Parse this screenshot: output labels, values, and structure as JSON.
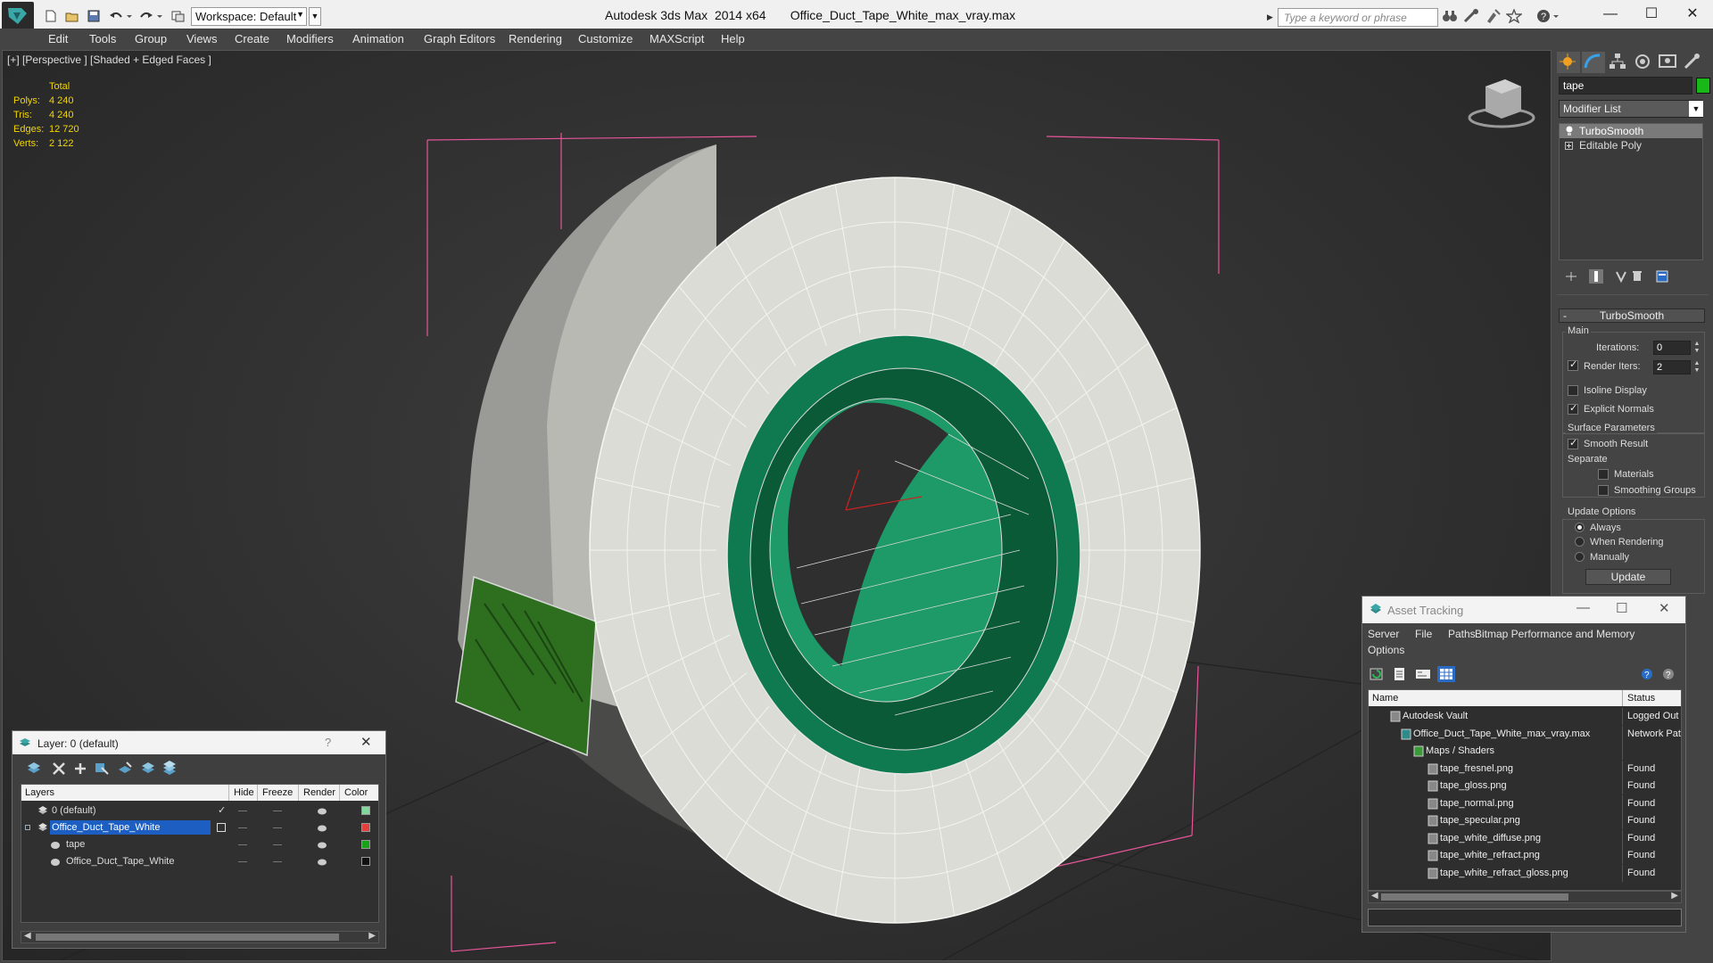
{
  "titlebar": {
    "workspace": "Workspace: Default",
    "title": "Autodesk 3ds Max  2014 x64       Office_Duct_Tape_White_max_vray.max",
    "search_placeholder": "Type a keyword or phrase"
  },
  "menu": [
    "Edit",
    "Tools",
    "Group",
    "Views",
    "Create",
    "Modifiers",
    "Animation",
    "Graph Editors",
    "Rendering",
    "Customize",
    "MAXScript",
    "Help"
  ],
  "viewport": {
    "label": "[+] [Perspective ] [Shaded + Edged Faces ]",
    "stats": {
      "header": "Total",
      "rows": [
        {
          "key": "Polys:",
          "value": "4 240"
        },
        {
          "key": "Tris:",
          "value": "4 240"
        },
        {
          "key": "Edges:",
          "value": "12 720"
        },
        {
          "key": "Verts:",
          "value": "2 122"
        }
      ]
    }
  },
  "command_panel": {
    "object_name": "tape",
    "object_color": "#18b818",
    "modifier_list": "Modifier List",
    "stack": [
      "TurboSmooth",
      "Editable Poly"
    ],
    "rollout": {
      "title": "TurboSmooth",
      "main_group": "Main",
      "iterations_label": "Iterations:",
      "iterations": "0",
      "render_iters_label": "Render Iters:",
      "render_iters": "2",
      "isoline": "Isoline Display",
      "explicit_normals": "Explicit Normals",
      "surface_group": "Surface Parameters",
      "smooth_result": "Smooth Result",
      "separate": "Separate",
      "materials": "Materials",
      "smoothing_groups": "Smoothing Groups",
      "update_group": "Update Options",
      "always": "Always",
      "when_rendering": "When Rendering",
      "manually": "Manually",
      "update_button": "Update"
    }
  },
  "layer_dialog": {
    "title": "Layer: 0 (default)",
    "help": "?",
    "columns": [
      "Layers",
      "Hide",
      "Freeze",
      "Render",
      "Color"
    ],
    "rows": [
      {
        "name": "0 (default)",
        "color": "#7fd99a",
        "indent": 0
      },
      {
        "name": "Office_Duct_Tape_White",
        "color": "#e0413a",
        "indent": 0
      },
      {
        "name": "tape",
        "color": "#17a317",
        "indent": 1
      },
      {
        "name": "Office_Duct_Tape_White",
        "color": "#111111",
        "indent": 1
      }
    ]
  },
  "asset_dialog": {
    "title": "Asset Tracking",
    "menu": [
      "Server",
      "File",
      "Paths",
      "Bitmap Performance and Memory",
      "Options"
    ],
    "columns": [
      "Name",
      "Status"
    ],
    "rows": [
      {
        "name": "Autodesk Vault",
        "status": "Logged Out",
        "indent": 0
      },
      {
        "name": "Office_Duct_Tape_White_max_vray.max",
        "status": "Network Pat",
        "indent": 1
      },
      {
        "name": "Maps / Shaders",
        "status": "",
        "indent": 2
      },
      {
        "name": "tape_fresnel.png",
        "status": "Found",
        "indent": 3
      },
      {
        "name": "tape_gloss.png",
        "status": "Found",
        "indent": 3
      },
      {
        "name": "tape_normal.png",
        "status": "Found",
        "indent": 3
      },
      {
        "name": "tape_specular.png",
        "status": "Found",
        "indent": 3
      },
      {
        "name": "tape_white_diffuse.png",
        "status": "Found",
        "indent": 3
      },
      {
        "name": "tape_white_refract.png",
        "status": "Found",
        "indent": 3
      },
      {
        "name": "tape_white_refract_gloss.png",
        "status": "Found",
        "indent": 3
      }
    ]
  }
}
